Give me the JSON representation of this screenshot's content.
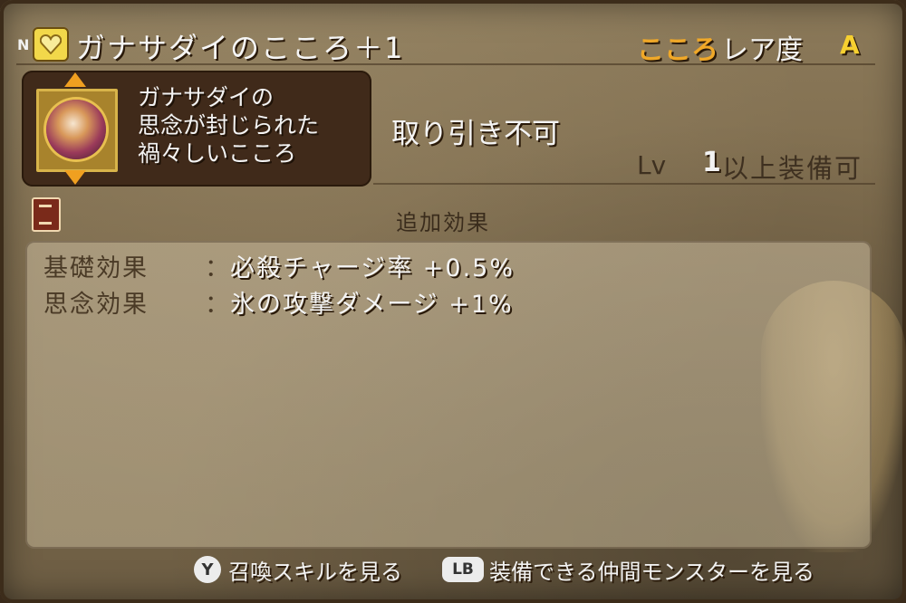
{
  "header": {
    "grade_mark": "N",
    "category_icon": "heart-icon",
    "title": "ガナサダイのこころ＋1",
    "rarity_kokoro": "こころ",
    "rarity_label": "レア度",
    "rarity_grade": "A"
  },
  "item": {
    "icon": "ganasadai-portrait-icon",
    "description_lines": [
      "ガナサダイの",
      "思念が封じられた",
      "禍々しいこころ"
    ],
    "trade_status": "取り引き不可",
    "level_label": "Lv",
    "level_value": "1",
    "level_suffix": "以上装備可"
  },
  "effects": {
    "section_title": "追加効果",
    "rows": [
      {
        "label": "基礎効果",
        "colon": "：",
        "value": "必殺チャージ率 +0.5%"
      },
      {
        "label": "思念効果",
        "colon": "：",
        "value": "氷の攻撃ダメージ +1%"
      }
    ]
  },
  "footer": {
    "y_button": "Y",
    "y_text": "召喚スキルを見る",
    "lb_button": "LB",
    "lb_text": "装備できる仲間モンスターを見る"
  },
  "colors": {
    "accent_orange": "#f0a828",
    "grade_yellow": "#f6d030",
    "panel_brown": "#402a1a"
  }
}
